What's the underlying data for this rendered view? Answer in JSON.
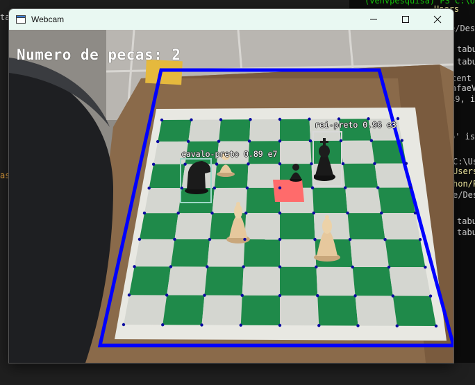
{
  "window": {
    "title": "Webcam",
    "icon": "window-app-icon",
    "controls": [
      "minimize-icon",
      "maximize-icon",
      "close-icon"
    ]
  },
  "overlay": {
    "piece_count_text": "Numero de pecas: 2",
    "detections": [
      {
        "label": "cavalo-preto 0.89 e7",
        "color": "#9fd8c8"
      },
      {
        "label": "rei-preto 0.96 e3",
        "color": "#d9d9d9"
      }
    ],
    "board_outline_color": "#0000ff",
    "highlight_color": "#ff6b6b"
  },
  "background_terminal": {
    "lines": [
      {
        "text": "(venvpesquisa) PS C:\\Us",
        "style": "green"
      },
      {
        "text": "Users",
        "style": "yellow"
      },
      {
        "text": "e/Des",
        "style": "plain"
      },
      {
        "text": "tabu",
        "style": "plain"
      },
      {
        "text": "tabu",
        "style": "plain"
      },
      {
        "text": "cent",
        "style": "plain"
      },
      {
        "text": "afaeV",
        "style": "plain"
      },
      {
        "text": "49, i",
        "style": "plain"
      },
      {
        "text": "p' is",
        "style": "plain"
      },
      {
        "text": "C:\\Us",
        "style": "plain"
      },
      {
        "text": "Users",
        "style": "yellow"
      },
      {
        "text": "hon/P",
        "style": "yellow"
      },
      {
        "text": "e/Des",
        "style": "plain"
      },
      {
        "text": "tabu",
        "style": "plain"
      },
      {
        "text": "tabu",
        "style": "plain"
      }
    ],
    "left_fragments": [
      "ta",
      "as"
    ]
  }
}
